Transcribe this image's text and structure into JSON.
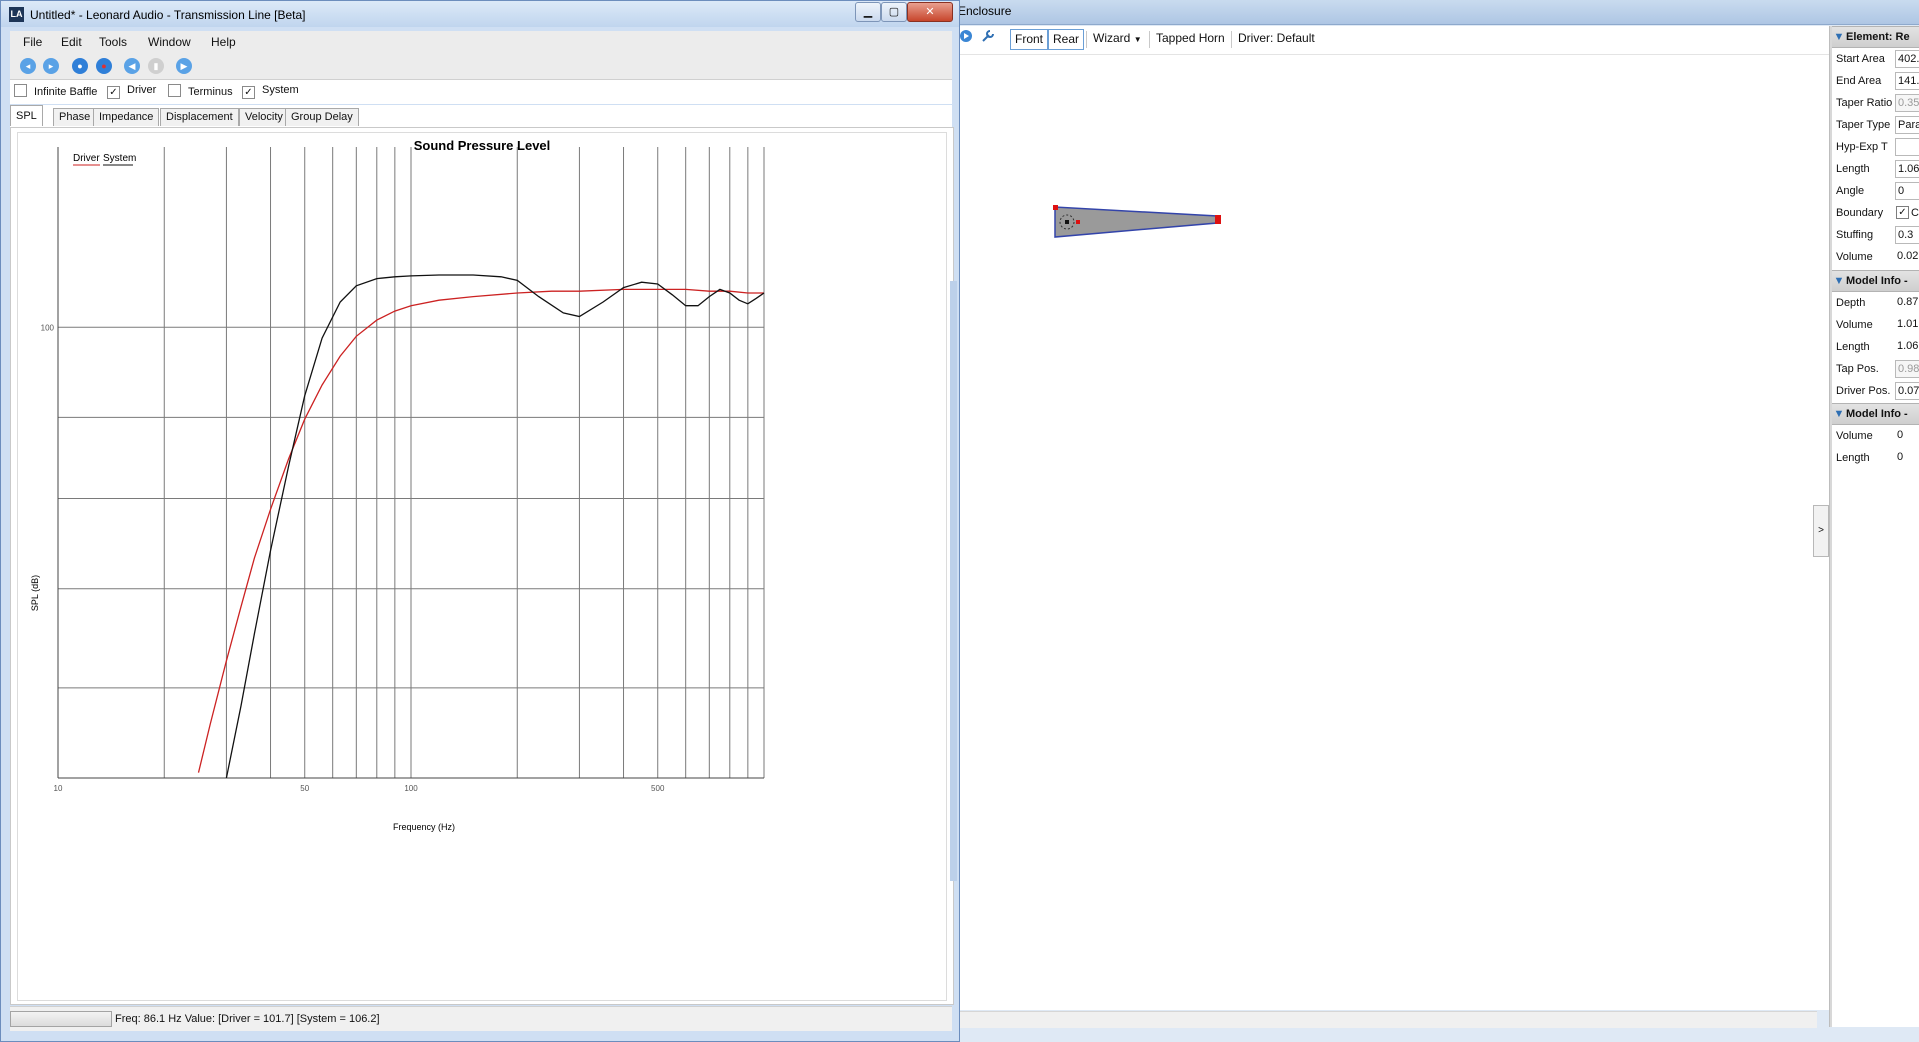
{
  "enclosure_window": {
    "title": "Enclosure",
    "toolbar": {
      "front_label": "Front",
      "rear_label": "Rear",
      "wizard_label": "Wizard",
      "tapped_horn_label": "Tapped Horn",
      "driver_label": "Driver: Default"
    },
    "collapse_glyph": ">"
  },
  "properties": {
    "element_header": "Element: Re",
    "element_rows": [
      {
        "label": "Start Area",
        "value": "402.",
        "style": "box"
      },
      {
        "label": "End Area",
        "value": "141.",
        "style": "box"
      },
      {
        "label": "Taper Ratio",
        "value": "0.35",
        "style": "grey"
      },
      {
        "label": "Taper Type",
        "value": "Para",
        "style": "box"
      },
      {
        "label": "Hyp-Exp T",
        "value": "",
        "style": "box"
      },
      {
        "label": "Length",
        "value": "1.06",
        "style": "box"
      },
      {
        "label": "Angle",
        "value": "0",
        "style": "box"
      },
      {
        "label": "Boundary",
        "value": "C",
        "style": "check"
      },
      {
        "label": "Stuffing",
        "value": "0.3",
        "style": "box"
      },
      {
        "label": "Volume",
        "value": "0.02",
        "style": "plain"
      }
    ],
    "model_header_1": "Model Info -",
    "model_rows_1": [
      {
        "label": "Depth",
        "value": "0.87",
        "style": "plain"
      },
      {
        "label": "Volume",
        "value": "1.01",
        "style": "plain"
      },
      {
        "label": "Length",
        "value": "1.06",
        "style": "plain"
      },
      {
        "label": "Tap Pos.",
        "value": "0.98",
        "style": "grey"
      },
      {
        "label": "Driver Pos.",
        "value": "0.07",
        "style": "box"
      }
    ],
    "model_header_2": "Model Info -",
    "model_rows_2": [
      {
        "label": "Volume",
        "value": "0",
        "style": "plain"
      },
      {
        "label": "Length",
        "value": "0",
        "style": "plain"
      }
    ]
  },
  "main_window": {
    "app_icon": "LA",
    "title": "Untitled* - Leonard Audio - Transmission Line [Beta]",
    "menu": [
      "File",
      "Edit",
      "Tools",
      "Window",
      "Help"
    ],
    "toolbar_icons": [
      "new-icon",
      "open-icon",
      "record-icon",
      "stop-icon",
      "rewind-icon",
      "pause-icon",
      "play-icon"
    ],
    "options": [
      {
        "label": "Infinite Baffle",
        "checked": false
      },
      {
        "label": "Driver",
        "checked": true
      },
      {
        "label": "Terminus",
        "checked": false
      },
      {
        "label": "System",
        "checked": true
      }
    ],
    "tabs": [
      "SPL",
      "Phase",
      "Impedance",
      "Displacement",
      "Velocity",
      "Group Delay"
    ],
    "active_tab": "SPL",
    "status": "Freq: 86.1 Hz    Value: [Driver = 101.7]   [System = 106.2]"
  },
  "colors": {
    "driver": "#cc2222",
    "system": "#111111",
    "accent": "#2f6fb3"
  },
  "chart_data": {
    "type": "line",
    "title": "Sound Pressure Level",
    "xlabel": "Frequency (Hz)",
    "ylabel": "SPL (dB)",
    "x_scale": "log",
    "xlim": [
      10,
      1000
    ],
    "ylim": [
      75,
      110
    ],
    "x_tick_labels": [
      {
        "value": 10,
        "label": "10"
      },
      {
        "value": 50,
        "label": "50"
      },
      {
        "value": 100,
        "label": "100"
      },
      {
        "value": 500,
        "label": "500"
      }
    ],
    "y_tick_labels": [
      {
        "value": 100,
        "label": "100"
      }
    ],
    "x_gridlines": [
      10,
      20,
      30,
      40,
      50,
      60,
      70,
      80,
      90,
      100,
      200,
      300,
      400,
      500,
      600,
      700,
      800,
      900,
      1000
    ],
    "y_gridlines": [
      80,
      85.5,
      90.5,
      95,
      100
    ],
    "grid": true,
    "legend_position": "top-left",
    "series": [
      {
        "name": "Driver",
        "color": "#cc2222",
        "x": [
          25,
          27,
          30,
          33,
          36,
          40,
          45,
          50,
          56,
          63,
          70,
          80,
          90,
          100,
          120,
          150,
          200,
          250,
          300,
          400,
          500,
          600,
          700,
          800,
          900,
          1000
        ],
        "y": [
          75.3,
          78,
          81.5,
          84.5,
          87.2,
          89.9,
          92.7,
          94.9,
          96.8,
          98.4,
          99.5,
          100.4,
          100.9,
          101.2,
          101.5,
          101.7,
          101.9,
          102.0,
          102.0,
          102.1,
          102.1,
          102.1,
          102.0,
          102.0,
          101.9,
          101.9
        ]
      },
      {
        "name": "System",
        "color": "#111111",
        "x": [
          30,
          33,
          36,
          40,
          45,
          50,
          56,
          63,
          70,
          80,
          90,
          100,
          120,
          150,
          180,
          200,
          230,
          270,
          300,
          350,
          400,
          450,
          500,
          550,
          600,
          650,
          700,
          750,
          800,
          850,
          900,
          950,
          1000
        ],
        "y": [
          75,
          79,
          83,
          87.6,
          92.3,
          96.2,
          99.4,
          101.4,
          102.3,
          102.7,
          102.8,
          102.85,
          102.9,
          102.9,
          102.8,
          102.6,
          101.7,
          100.8,
          100.6,
          101.4,
          102.2,
          102.5,
          102.4,
          101.8,
          101.2,
          101.2,
          101.7,
          102.1,
          101.9,
          101.5,
          101.3,
          101.6,
          101.9
        ]
      }
    ]
  }
}
